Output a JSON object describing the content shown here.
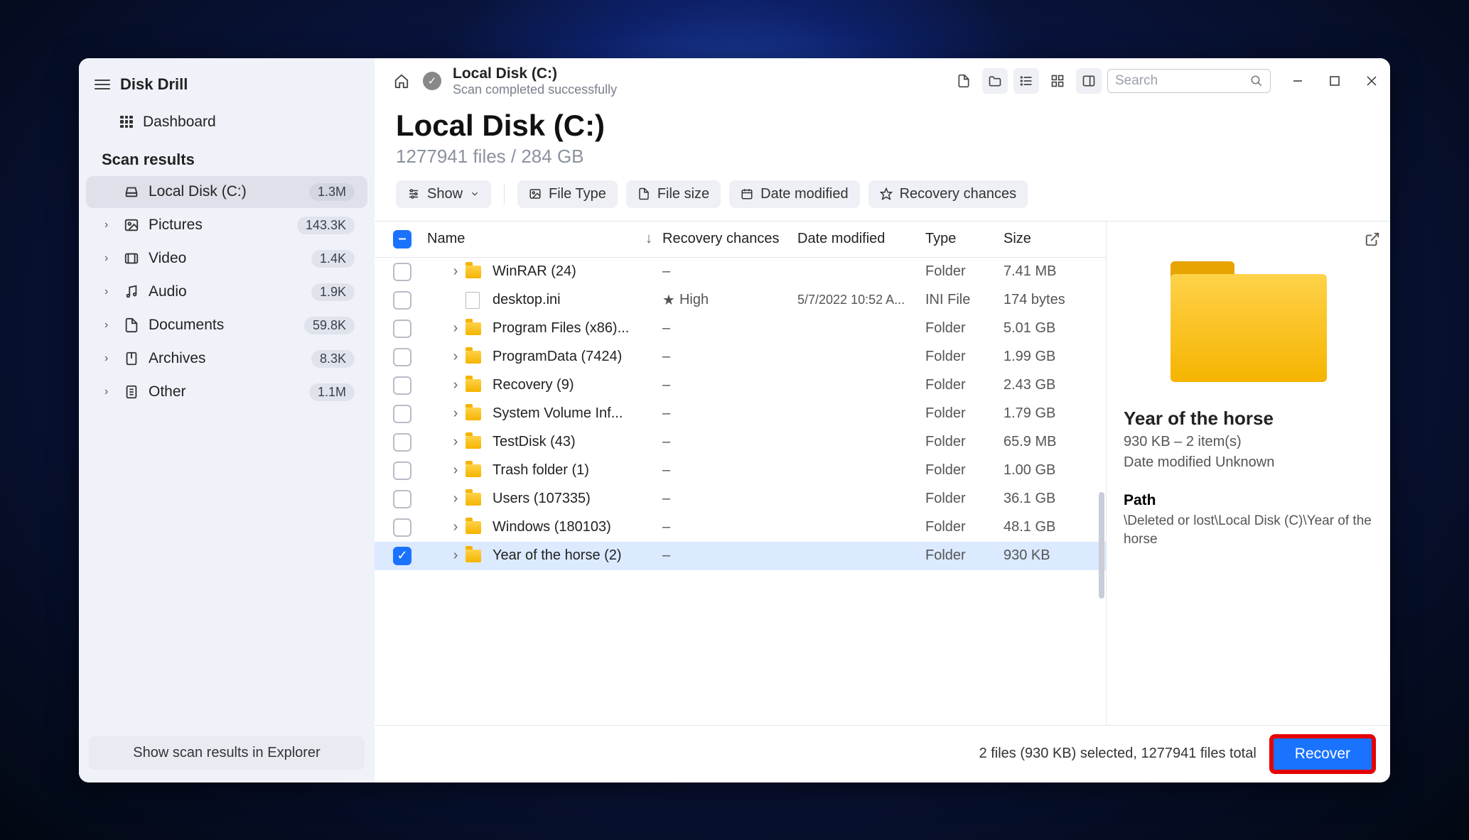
{
  "app": {
    "title": "Disk Drill"
  },
  "dashboard": {
    "label": "Dashboard"
  },
  "section": {
    "label": "Scan results"
  },
  "sidebar": {
    "items": [
      {
        "label": "Local Disk (C:)",
        "count": "1.3M",
        "icon": "disk"
      },
      {
        "label": "Pictures",
        "count": "143.3K",
        "icon": "picture"
      },
      {
        "label": "Video",
        "count": "1.4K",
        "icon": "video"
      },
      {
        "label": "Audio",
        "count": "1.9K",
        "icon": "audio"
      },
      {
        "label": "Documents",
        "count": "59.8K",
        "icon": "document"
      },
      {
        "label": "Archives",
        "count": "8.3K",
        "icon": "archive"
      },
      {
        "label": "Other",
        "count": "1.1M",
        "icon": "other"
      }
    ]
  },
  "explorer_btn": "Show scan results in Explorer",
  "breadcrumb": {
    "title": "Local Disk (C:)",
    "sub": "Scan completed successfully"
  },
  "search": {
    "placeholder": "Search"
  },
  "page": {
    "title": "Local Disk (C:)",
    "sub": "1277941 files / 284 GB"
  },
  "filters": {
    "show": "Show",
    "file_type": "File Type",
    "file_size": "File size",
    "date_modified": "Date modified",
    "recovery": "Recovery chances"
  },
  "columns": {
    "name": "Name",
    "recovery": "Recovery chances",
    "date": "Date modified",
    "type": "Type",
    "size": "Size"
  },
  "rows": [
    {
      "name": "WinRAR (24)",
      "recovery": "–",
      "date": "",
      "type": "Folder",
      "size": "7.41 MB",
      "kind": "folder",
      "expand": true
    },
    {
      "name": "desktop.ini",
      "recovery": "High",
      "date": "5/7/2022 10:52 A...",
      "type": "INI File",
      "size": "174 bytes",
      "kind": "file",
      "expand": false,
      "star": true
    },
    {
      "name": "Program Files (x86)...",
      "recovery": "–",
      "date": "",
      "type": "Folder",
      "size": "5.01 GB",
      "kind": "folder",
      "expand": true
    },
    {
      "name": "ProgramData (7424)",
      "recovery": "–",
      "date": "",
      "type": "Folder",
      "size": "1.99 GB",
      "kind": "folder",
      "expand": true
    },
    {
      "name": "Recovery (9)",
      "recovery": "–",
      "date": "",
      "type": "Folder",
      "size": "2.43 GB",
      "kind": "folder",
      "expand": true
    },
    {
      "name": "System Volume Inf...",
      "recovery": "–",
      "date": "",
      "type": "Folder",
      "size": "1.79 GB",
      "kind": "folder",
      "expand": true
    },
    {
      "name": "TestDisk (43)",
      "recovery": "–",
      "date": "",
      "type": "Folder",
      "size": "65.9 MB",
      "kind": "folder",
      "expand": true
    },
    {
      "name": "Trash folder (1)",
      "recovery": "–",
      "date": "",
      "type": "Folder",
      "size": "1.00 GB",
      "kind": "folder",
      "expand": true
    },
    {
      "name": "Users (107335)",
      "recovery": "–",
      "date": "",
      "type": "Folder",
      "size": "36.1 GB",
      "kind": "folder",
      "expand": true
    },
    {
      "name": "Windows (180103)",
      "recovery": "–",
      "date": "",
      "type": "Folder",
      "size": "48.1 GB",
      "kind": "folder",
      "expand": true
    },
    {
      "name": "Year of the horse (2)",
      "recovery": "–",
      "date": "",
      "type": "Folder",
      "size": "930 KB",
      "kind": "folder",
      "expand": true,
      "selected": true,
      "checked": true
    }
  ],
  "details": {
    "title": "Year of the horse",
    "sub": "930 KB – 2 item(s)",
    "date": "Date modified Unknown",
    "path_label": "Path",
    "path": "\\Deleted or lost\\Local Disk (C)\\Year of the horse"
  },
  "footer": {
    "text": "2 files (930 KB) selected, 1277941 files total",
    "recover": "Recover"
  }
}
